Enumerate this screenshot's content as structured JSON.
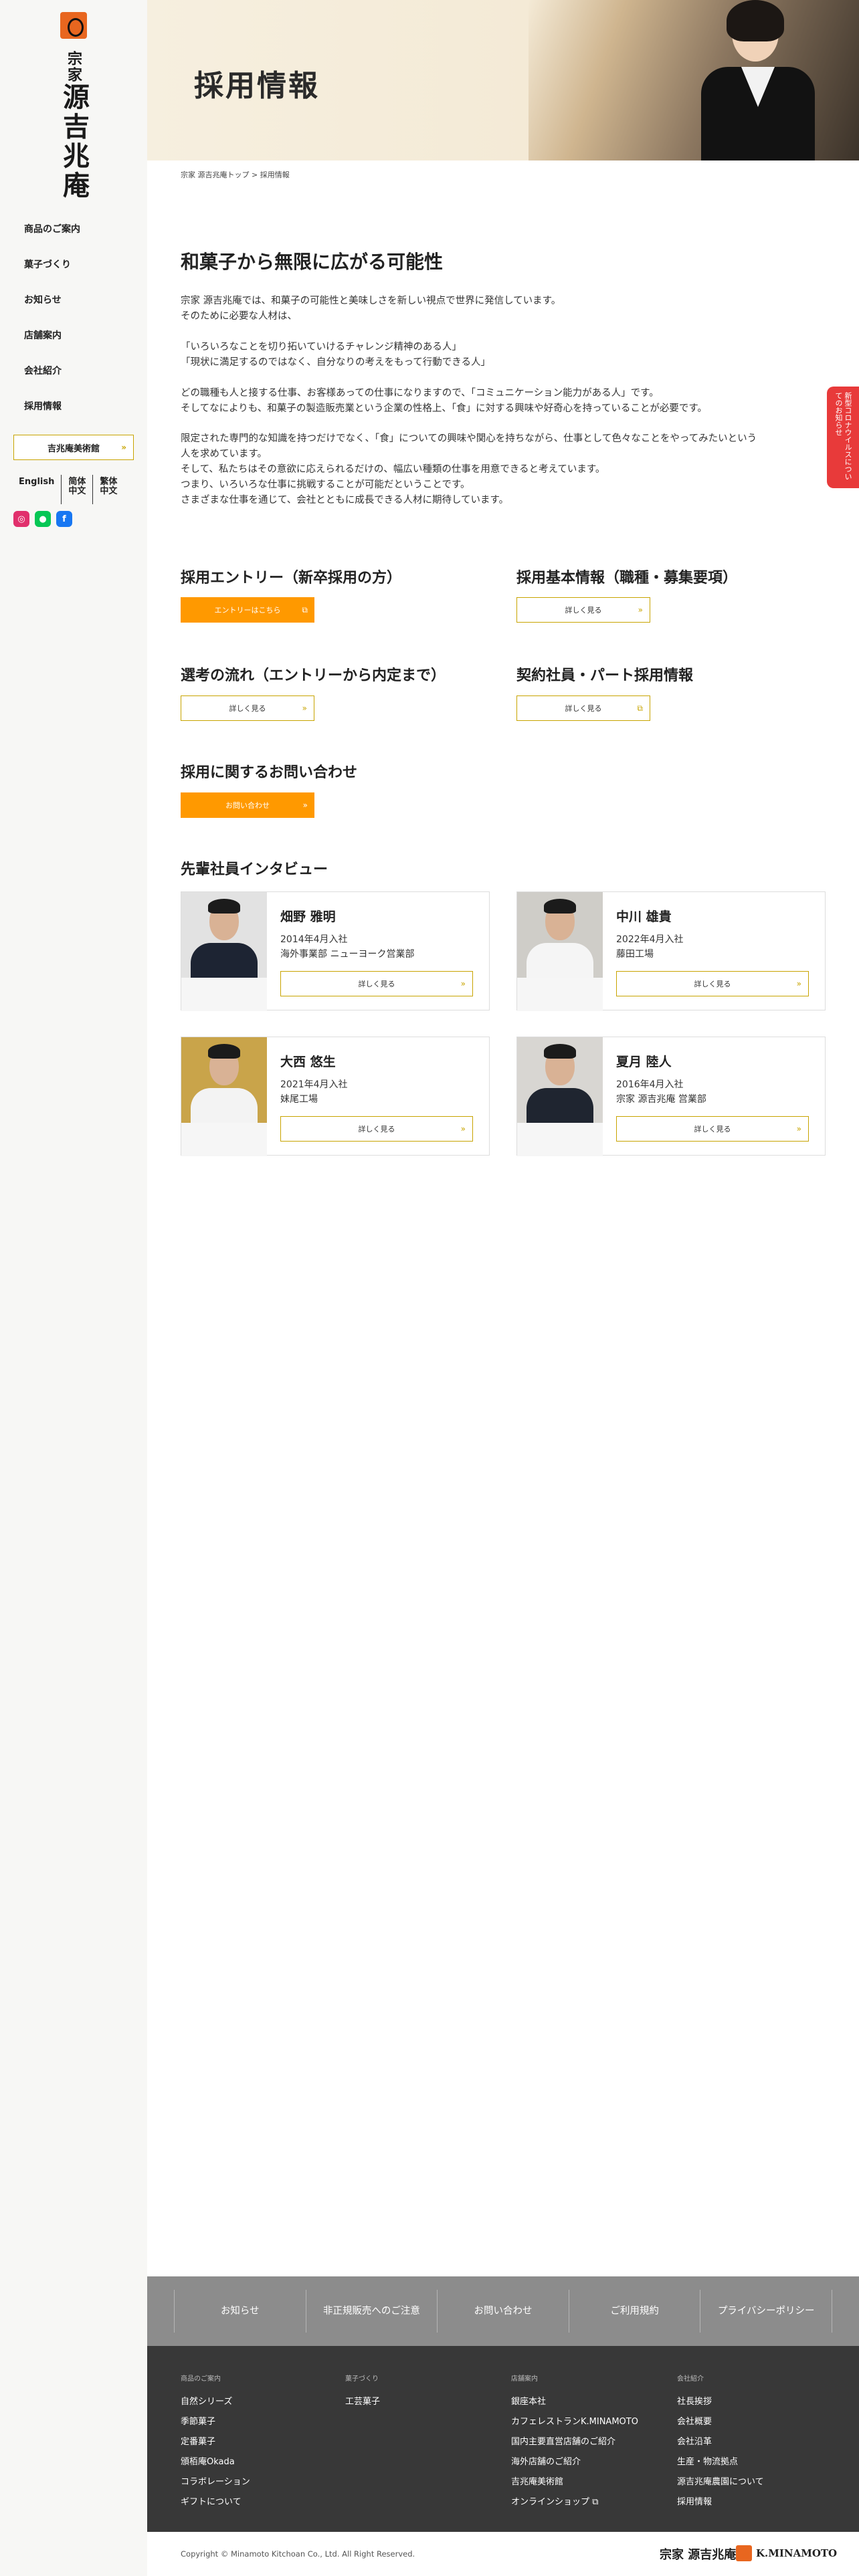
{
  "sidebar": {
    "logo_small": "宗家",
    "logo_main": "源吉兆庵",
    "nav": [
      "商品のご案内",
      "菓子づくり",
      "お知らせ",
      "店舗案内",
      "会社紹介",
      "採用情報"
    ],
    "museum": "吉兆庵美術館",
    "languages": [
      "English",
      "简体\n中文",
      "繁体\n中文"
    ],
    "social_icons": [
      "instagram-icon",
      "line-icon",
      "facebook-icon"
    ]
  },
  "hero": {
    "title": "採用情報"
  },
  "breadcrumb": {
    "home": "宗家 源吉兆庵トップ",
    "sep": ">",
    "current": "採用情報"
  },
  "intro": {
    "heading": "和菓子から無限に広がる可能性",
    "p1a": "宗家 源吉兆庵では、和菓子の可能性と美味しさを新しい視点で世界に発信しています。",
    "p1b": "そのために必要な人材は、",
    "p2a": "「いろいろなことを切り拓いていけるチャレンジ精神のある人」",
    "p2b": "「現状に満足するのではなく、自分なりの考えをもって行動できる人」",
    "p3a": "どの職種も人と接する仕事、お客様あっての仕事になりますので、「コミュニケーション能力がある人」です。",
    "p3b": "そしてなによりも、和菓子の製造販売業という企業の性格上、「食」に対する興味や好奇心を持っていることが必要です。",
    "p4a": "限定された専門的な知識を持つだけでなく、「食」についての興味や関心を持ちながら、仕事として色々なことをやってみたいという",
    "p4b": "人を求めています。",
    "p4c": "そして、私たちはその意欲に応えられるだけの、幅広い種類の仕事を用意できると考えています。",
    "p4d": "つまり、いろいろな仕事に挑戦することが可能だということです。",
    "p4e": "さまざまな仕事を通じて、会社とともに成長できる人材に期待しています。"
  },
  "sections": {
    "entry": {
      "title": "採用エントリー（新卒採用の方）",
      "button": "エントリーはこちら"
    },
    "basic": {
      "title": "採用基本情報（職種・募集要項）",
      "button": "詳しく見る"
    },
    "flow": {
      "title": "選考の流れ（エントリーから内定まで）",
      "button": "詳しく見る"
    },
    "contract": {
      "title": "契約社員・パート採用情報",
      "button": "詳しく見る"
    },
    "contact": {
      "title": "採用に関するお問い合わせ",
      "button": "お問い合わせ"
    }
  },
  "interviews": {
    "heading": "先輩社員インタビュー",
    "people": [
      {
        "name": "畑野 雅明",
        "line1": "2014年4月入社",
        "line2": "海外事業部 ニューヨーク営業部",
        "button": "詳しく見る"
      },
      {
        "name": "中川 雄貴",
        "line1": "2022年4月入社",
        "line2": "藤田工場",
        "button": "詳しく見る"
      },
      {
        "name": "大西 悠生",
        "line1": "2021年4月入社",
        "line2": "妹尾工場",
        "button": "詳しく見る"
      },
      {
        "name": "夏月 陸人",
        "line1": "2016年4月入社",
        "line2": "宗家 源吉兆庵 営業部",
        "button": "詳しく見る"
      }
    ]
  },
  "side_tab": "新型コロナウイルスについてのお知らせ",
  "footer": {
    "nav": [
      "お知らせ",
      "非正規販売へのご注意",
      "お問い合わせ",
      "ご利用規約",
      "プライバシーポリシー"
    ],
    "col1": {
      "head": "商品のご案内",
      "items": [
        "自然シリーズ",
        "季節菓子",
        "定番菓子",
        "頒栢庵Okada",
        "コラボレーション",
        "ギフトについて"
      ]
    },
    "col2": {
      "head": "菓子づくり",
      "items": [
        "工芸菓子"
      ]
    },
    "col3": {
      "head": "店舗案内",
      "items": [
        "銀座本社",
        "カフェレストランK.MINAMOTO",
        "国内主要直営店舗のご紹介",
        "海外店舗のご紹介",
        "吉兆庵美術館",
        "オンラインショップ"
      ]
    },
    "col4": {
      "head": "会社紹介",
      "items": [
        "社長挨拶",
        "会社概要",
        "会社沿革",
        "生産・物流拠点",
        "源吉兆庵農園について",
        "採用情報"
      ]
    },
    "copyright": "Copyright © Minamoto Kitchoan Co., Ltd. All Right Reserved.",
    "logo1": "宗家 源吉兆庵",
    "logo2": "K.MINAMOTO"
  },
  "colors": {
    "accent": "#ff9900",
    "gold": "#c8a400",
    "red_tab": "#e83a3a",
    "footer_dark": "#383838"
  }
}
